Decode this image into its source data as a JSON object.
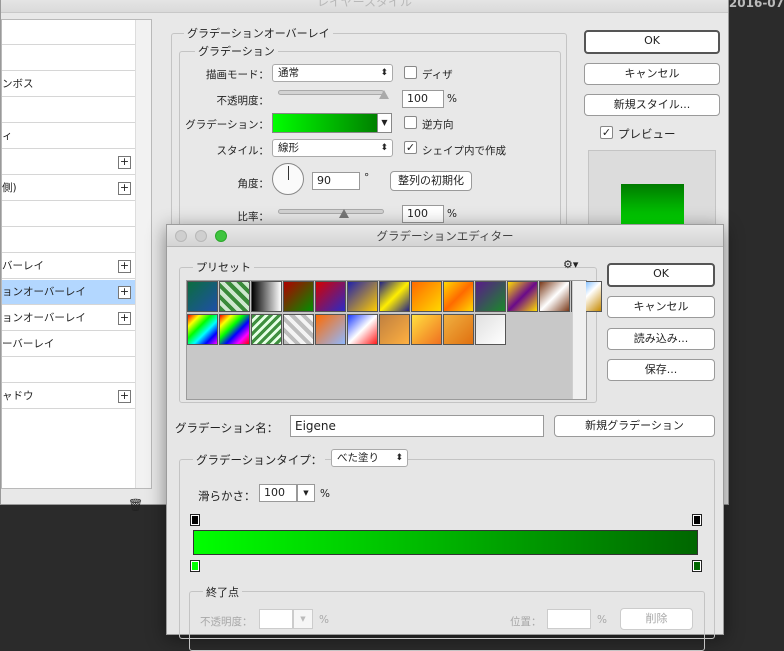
{
  "desktop": {
    "date_fragment": "2016-07"
  },
  "layer_style": {
    "title": "レイヤースタイル",
    "sidebar_items": [
      {
        "label": "",
        "plus": false,
        "selected": false
      },
      {
        "label": "",
        "plus": false,
        "selected": false
      },
      {
        "label": "ンボス",
        "plus": false,
        "selected": false
      },
      {
        "label": "",
        "plus": false,
        "selected": false
      },
      {
        "label": "ィ",
        "plus": false,
        "selected": false
      },
      {
        "label": "",
        "plus": true,
        "selected": false
      },
      {
        "label": "側)",
        "plus": true,
        "selected": false
      },
      {
        "label": "",
        "plus": false,
        "selected": false
      },
      {
        "label": "",
        "plus": false,
        "selected": false
      },
      {
        "label": "バーレイ",
        "plus": true,
        "selected": false
      },
      {
        "label": "ョンオーバーレイ",
        "plus": true,
        "selected": true
      },
      {
        "label": "ョンオーバーレイ",
        "plus": true,
        "selected": false
      },
      {
        "label": "ーバーレイ",
        "plus": false,
        "selected": false
      },
      {
        "label": "",
        "plus": false,
        "selected": false
      },
      {
        "label": "ャドウ",
        "plus": true,
        "selected": false
      }
    ],
    "section_title": "グラデーションオーバーレイ",
    "group_title": "グラデーション",
    "blend_mode_label": "描画モード：",
    "blend_mode_value": "通常",
    "dither_label": "ディザ",
    "opacity_label": "不透明度：",
    "opacity_value": "100",
    "opacity_unit": "%",
    "gradient_label": "グラデーション：",
    "reverse_label": "逆方向",
    "style_label": "スタイル：",
    "style_value": "線形",
    "align_label": "シェイプ内で作成",
    "angle_label": "角度：",
    "angle_value": "90",
    "angle_unit": "°",
    "reset_align_label": "整列の初期化",
    "scale_label": "比率：",
    "scale_value": "100",
    "scale_unit": "%",
    "ok_label": "OK",
    "cancel_label": "キャンセル",
    "new_style_label": "新規スタイル...",
    "preview_label": "プレビュー"
  },
  "gradient_editor": {
    "title": "グラデーションエディター",
    "presets_label": "プリセット",
    "gear_icon": "gear-icon",
    "ok_label": "OK",
    "cancel_label": "キャンセル",
    "load_label": "読み込み...",
    "save_label": "保存...",
    "name_label": "グラデーション名：",
    "name_value": "Eigene",
    "new_gradient_label": "新規グラデーション",
    "type_label": "グラデーションタイプ：",
    "type_value": "べた塗り",
    "smoothness_label": "滑らかさ：",
    "smoothness_value": "100",
    "smoothness_unit": "%",
    "stops_group": "終了点",
    "stop_opacity_label": "不透明度：",
    "stop_opacity_unit": "%",
    "location_label": "位置：",
    "location_unit": "%",
    "delete_label": "削除",
    "gradient_start_color": "#00ff00",
    "gradient_end_color": "#006600"
  }
}
